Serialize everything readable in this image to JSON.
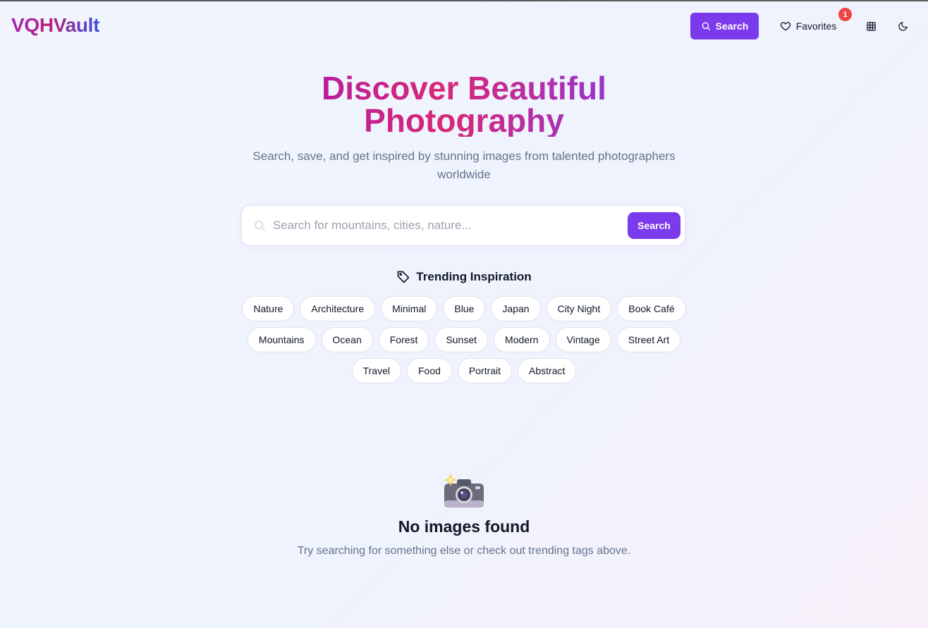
{
  "brand": {
    "name": "VQHVault"
  },
  "nav": {
    "search_label": "Search",
    "favorites_label": "Favorites",
    "favorites_count": "1"
  },
  "hero": {
    "title": "Discover Beautiful Photography",
    "subtitle": "Search, save, and get inspired by stunning images from talented photographers worldwide"
  },
  "search": {
    "placeholder": "Search for mountains, cities, nature...",
    "value": "",
    "button_label": "Search"
  },
  "trending": {
    "title": "Trending Inspiration",
    "tags": [
      "Nature",
      "Architecture",
      "Minimal",
      "Blue",
      "Japan",
      "City Night",
      "Book Café",
      "Mountains",
      "Ocean",
      "Forest",
      "Sunset",
      "Modern",
      "Vintage",
      "Street Art",
      "Travel",
      "Food",
      "Portrait",
      "Abstract"
    ]
  },
  "empty_state": {
    "icon": "camera-with-flash-icon",
    "title": "No images found",
    "message": "Try searching for something else or check out trending tags above."
  },
  "colors": {
    "accent": "#7c3aed",
    "badge": "#ef4444",
    "muted_text": "#64748b"
  }
}
